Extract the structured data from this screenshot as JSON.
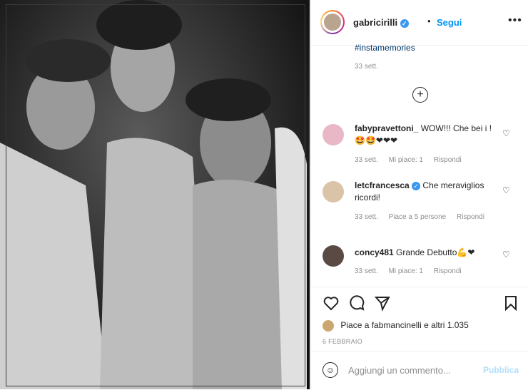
{
  "post": {
    "username": "gabricirilli",
    "follow_label": "Segui",
    "dot": "•",
    "more": "•••",
    "caption_hashtag": "#instamemories",
    "caption_time": "33 sett.",
    "load_more": "+"
  },
  "comments": [
    {
      "username": "fabypravettoni_",
      "text": "WOW!!! Che bei i !🤩🤩❤❤❤",
      "time": "33 sett.",
      "likes": "Mi piace: 1",
      "reply": "Rispondi",
      "avatar_color": "#e8b8c6"
    },
    {
      "username": "letcfrancesca",
      "text": "Che meraviglios ricordi!",
      "time": "33 sett.",
      "likes": "Piace a 5 persone",
      "reply": "Rispondi",
      "avatar_color": "#d9c4a8"
    },
    {
      "username": "concy481",
      "text": "Grande Debutto💪❤",
      "time": "33 sett.",
      "likes": "Mi piace: 1",
      "reply": "Rispondi",
      "avatar_color": "#5a4a44"
    }
  ],
  "actions": {
    "like_icon": "heart-icon",
    "comment_icon": "comment-icon",
    "share_icon": "share-icon",
    "save_icon": "bookmark-icon",
    "likes_text": "Piace a fabmancinelli e altri 1.035",
    "date": "6 FEBBRAIO"
  },
  "composer": {
    "placeholder": "Aggiungi un commento...",
    "publish": "Pubblica"
  }
}
